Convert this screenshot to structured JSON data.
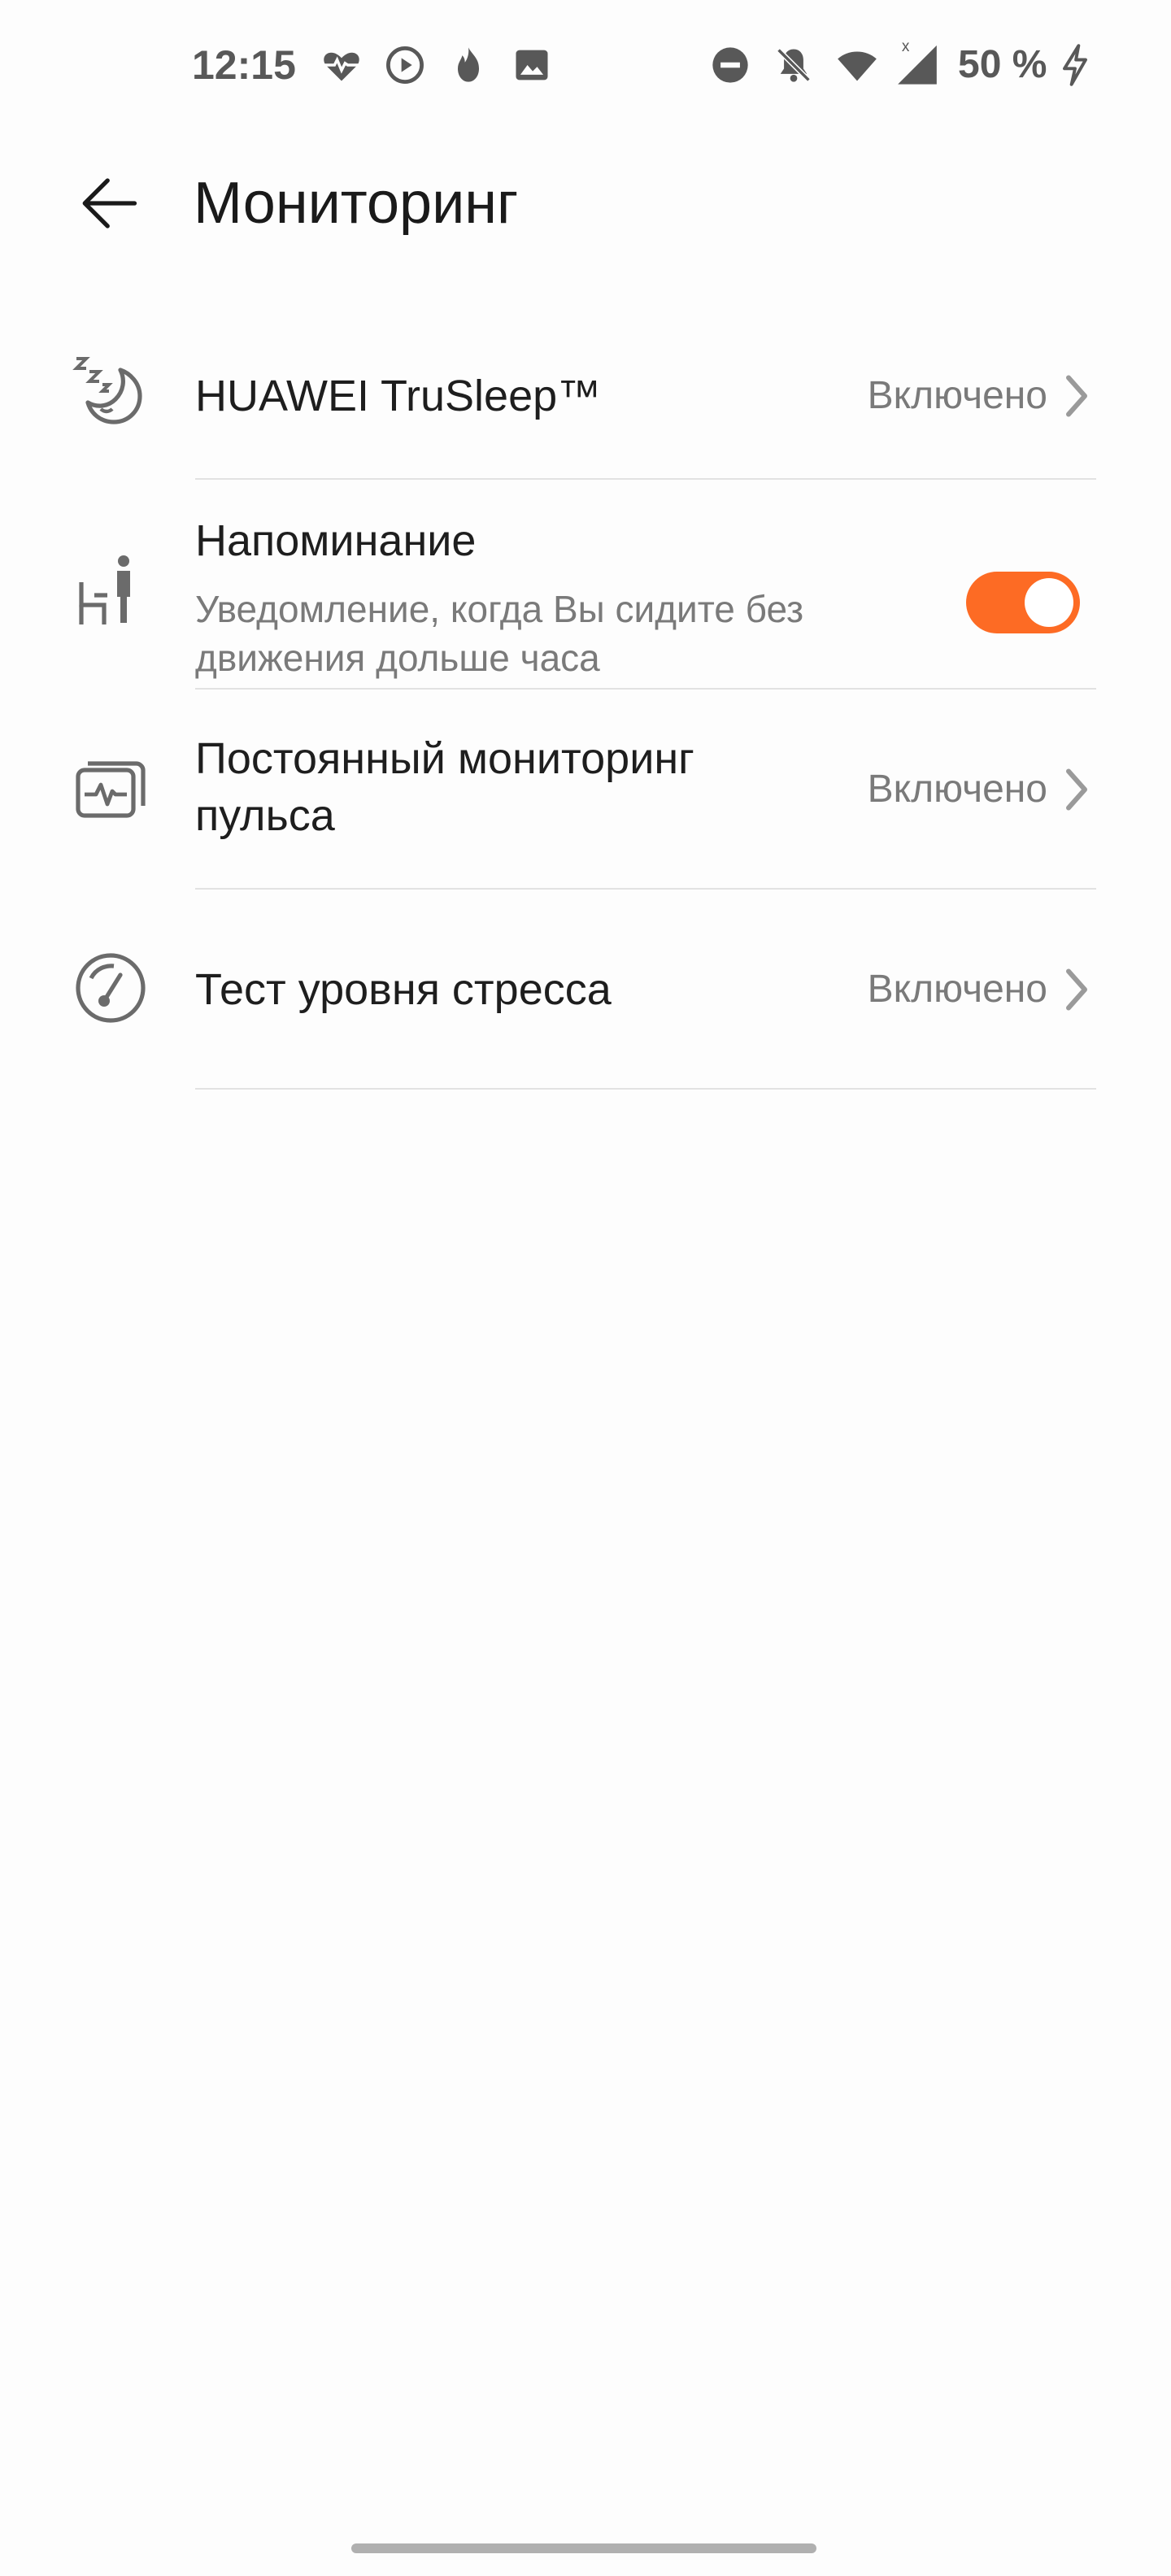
{
  "status_bar": {
    "time": "12:15",
    "battery": "50 %",
    "icons_left": [
      "heart-rate-icon",
      "play-circle-icon",
      "flame-icon",
      "image-icon"
    ],
    "icons_right": [
      "do-not-disturb-icon",
      "bell-off-icon",
      "wifi-icon",
      "signal-icon",
      "charging-icon"
    ]
  },
  "header": {
    "title": "Мониторинг",
    "back_icon": "arrow-left-icon"
  },
  "items": [
    {
      "icon": "sleep-moon-icon",
      "title": "HUAWEI TruSleep™",
      "value": "Включено"
    },
    {
      "icon": "sitting-person-icon",
      "title": "Напоминание",
      "subtitle_line1": "Уведомление, когда Вы сидите без",
      "subtitle_line2": "движения дольше часа",
      "toggle_on": true
    },
    {
      "icon": "heart-monitor-icon",
      "title_line1": "Постоянный мониторинг",
      "title_line2": "пульса",
      "value": "Включено"
    },
    {
      "icon": "stress-gauge-icon",
      "title": "Тест уровня стресса",
      "value": "Включено"
    }
  ],
  "colors": {
    "accent": "#fd6b24",
    "text_primary": "#1e1e1e",
    "text_secondary": "#7a7a7a",
    "icon": "#6b6b6b",
    "divider": "#e2e2e2"
  }
}
